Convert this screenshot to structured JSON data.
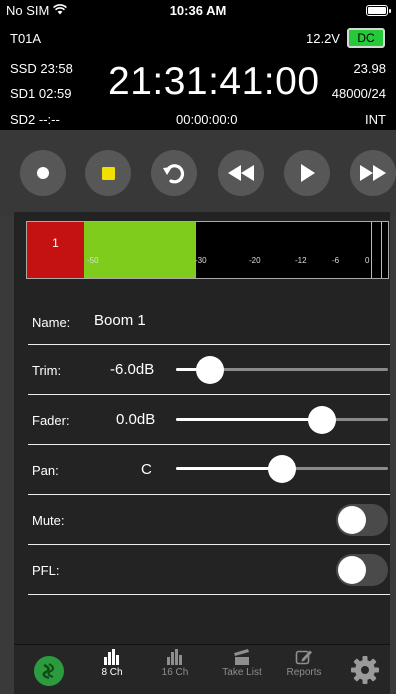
{
  "status_bar": {
    "carrier": "No SIM",
    "time": "10:36 AM",
    "wifi_icon": "wifi-icon",
    "battery_icon": "battery-icon"
  },
  "timecode_panel": {
    "take_name": "T01A",
    "voltage": "12.2V",
    "power_badge": "DC",
    "ssd": "SSD 23:58",
    "sd1": "SD1 02:59",
    "sd2": "SD2 --:--",
    "timecode": "21:31:41:00",
    "frame_rate": "23.98",
    "sample_rate": "48000/24",
    "elapsed": "00:00:00:0",
    "source": "INT",
    "badge_color": "#25c93a"
  },
  "transport": [
    {
      "name": "record",
      "icon": "record-icon"
    },
    {
      "name": "stop",
      "icon": "stop-icon",
      "color": "#f0e000"
    },
    {
      "name": "repeat",
      "icon": "repeat-icon"
    },
    {
      "name": "rewind",
      "icon": "rewind-icon"
    },
    {
      "name": "play",
      "icon": "play-icon"
    },
    {
      "name": "fast_forward",
      "icon": "fast-forward-icon"
    }
  ],
  "meter": {
    "channel": "1",
    "channel_color": "#c41212",
    "level_color": "#7fcc1c",
    "level_fraction": 0.37,
    "scale": [
      "-50",
      "-30",
      "-20",
      "-12",
      "-6",
      "0"
    ]
  },
  "channel_settings": {
    "name_label": "Name:",
    "name_value": "Boom 1",
    "trim_label": "Trim:",
    "trim_value": "-6.0dB",
    "trim_position": 0.16,
    "fader_label": "Fader:",
    "fader_value": "0.0dB",
    "fader_position": 0.69,
    "pan_label": "Pan:",
    "pan_value": "C",
    "pan_position": 0.5,
    "mute_label": "Mute:",
    "mute_on": false,
    "pfl_label": "PFL:",
    "pfl_on": false
  },
  "tab_bar": {
    "tabs": [
      {
        "label": "8 Ch",
        "icon": "bar-chart-icon",
        "active": true
      },
      {
        "label": "16 Ch",
        "icon": "bar-chart-icon",
        "active": false
      },
      {
        "label": "Take List",
        "icon": "clapperboard-icon",
        "active": false
      },
      {
        "label": "Reports",
        "icon": "edit-icon",
        "active": false
      }
    ],
    "logo_icon": "app-logo-icon",
    "settings_icon": "gear-icon"
  }
}
